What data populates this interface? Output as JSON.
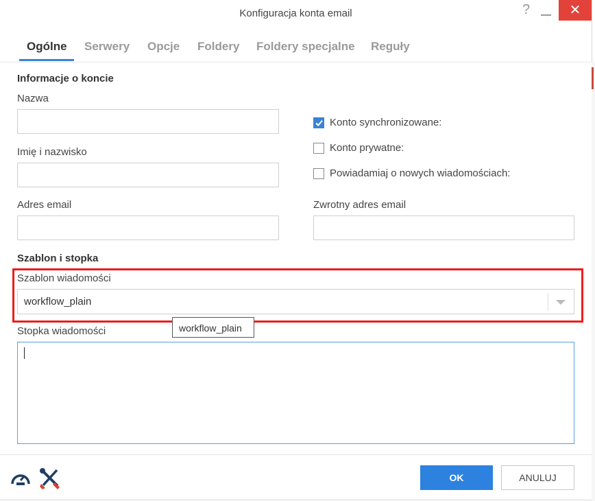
{
  "window": {
    "title": "Konfiguracja konta email",
    "help_label": "?",
    "close_label": "✕"
  },
  "tabs": [
    {
      "label": "Ogólne",
      "active": true
    },
    {
      "label": "Serwery",
      "active": false
    },
    {
      "label": "Opcje",
      "active": false
    },
    {
      "label": "Foldery",
      "active": false
    },
    {
      "label": "Foldery specjalne",
      "active": false
    },
    {
      "label": "Reguły",
      "active": false
    }
  ],
  "account_info": {
    "heading": "Informacje o koncie",
    "name_label": "Nazwa",
    "name_value": "",
    "fullname_label": "Imię i nazwisko",
    "fullname_value": "",
    "email_label": "Adres email",
    "email_value": "",
    "reply_email_label": "Zwrotny adres email",
    "reply_email_value": "",
    "checkboxes": [
      {
        "label": "Konto synchronizowane:",
        "checked": true
      },
      {
        "label": "Konto prywatne:",
        "checked": false
      },
      {
        "label": "Powiadamiaj o nowych wiadomościach:",
        "checked": false
      }
    ]
  },
  "template": {
    "heading": "Szablon i stopka",
    "template_label": "Szablon wiadomości",
    "template_value": "workflow_plain",
    "tooltip": "workflow_plain",
    "footer_label": "Stopka wiadomości",
    "footer_value": ""
  },
  "buttons": {
    "ok": "OK",
    "cancel": "ANULUJ"
  },
  "colors": {
    "accent": "#2d82e0",
    "highlight": "#ee1c1c",
    "close": "#e3423a"
  }
}
